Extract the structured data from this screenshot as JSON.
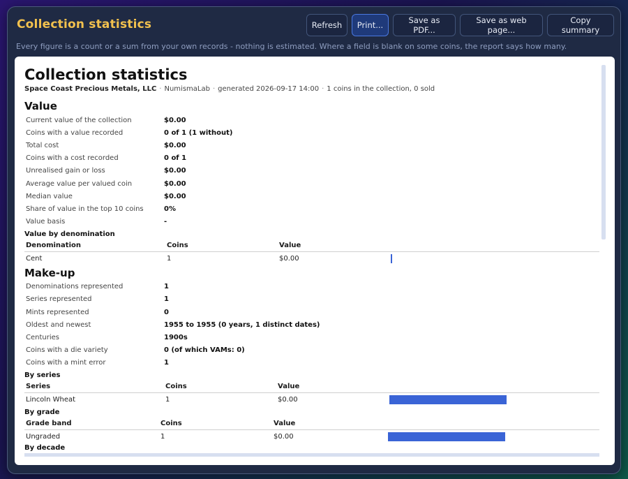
{
  "window": {
    "title": "Collection statistics",
    "subtitle": "Every figure is a count or a sum from your own records - nothing is estimated. Where a field is blank on some coins, the report says how many."
  },
  "toolbar": {
    "refresh": "Refresh",
    "print": "Print...",
    "save_pdf": "Save as PDF...",
    "save_web": "Save as web page...",
    "copy_summary": "Copy summary"
  },
  "report": {
    "heading": "Collection statistics",
    "org": "Space Coast Precious Metals, LLC",
    "app": "NumismaLab",
    "generated": "generated 2026-09-17 14:00",
    "count": "1 coins in the collection, 0 sold",
    "value_section": {
      "title": "Value",
      "rows": [
        {
          "k": "Current value of the collection",
          "v": "$0.00"
        },
        {
          "k": "Coins with a value recorded",
          "v": "0 of 1 (1 without)"
        },
        {
          "k": "Total cost",
          "v": "$0.00"
        },
        {
          "k": "Coins with a cost recorded",
          "v": "0 of 1"
        },
        {
          "k": "Unrealised gain or loss",
          "v": "$0.00"
        },
        {
          "k": "Average value per valued coin",
          "v": "$0.00"
        },
        {
          "k": "Median value",
          "v": "$0.00"
        },
        {
          "k": "Share of value in the top 10 coins",
          "v": "0%"
        },
        {
          "k": "Value basis",
          "v": "-"
        }
      ]
    },
    "by_denomination": {
      "title": "Value by denomination",
      "headers": [
        "Denomination",
        "Coins",
        "Value"
      ],
      "rows": [
        {
          "name": "Cent",
          "coins": "1",
          "value": "$0.00",
          "share": 0.01
        }
      ]
    },
    "makeup_section": {
      "title": "Make-up",
      "rows": [
        {
          "k": "Denominations represented",
          "v": "1"
        },
        {
          "k": "Series represented",
          "v": "1"
        },
        {
          "k": "Mints represented",
          "v": "0"
        },
        {
          "k": "Oldest and newest",
          "v": "1955 to 1955 (0 years, 1 distinct dates)"
        },
        {
          "k": "Centuries",
          "v": "1900s"
        },
        {
          "k": "Coins with a die variety",
          "v": "0 (of which VAMs: 0)"
        },
        {
          "k": "Coins with a mint error",
          "v": "1"
        }
      ]
    },
    "by_series": {
      "title": "By series",
      "headers": [
        "Series",
        "Coins",
        "Value"
      ],
      "rows": [
        {
          "name": "Lincoln Wheat",
          "coins": "1",
          "value": "$0.00",
          "share": 1.0
        }
      ]
    },
    "by_grade": {
      "title": "By grade",
      "headers": [
        "Grade band",
        "Coins",
        "Value"
      ],
      "rows": [
        {
          "name": "Ungraded",
          "coins": "1",
          "value": "$0.00",
          "share": 1.0
        }
      ]
    },
    "cut_off": "By decade"
  }
}
